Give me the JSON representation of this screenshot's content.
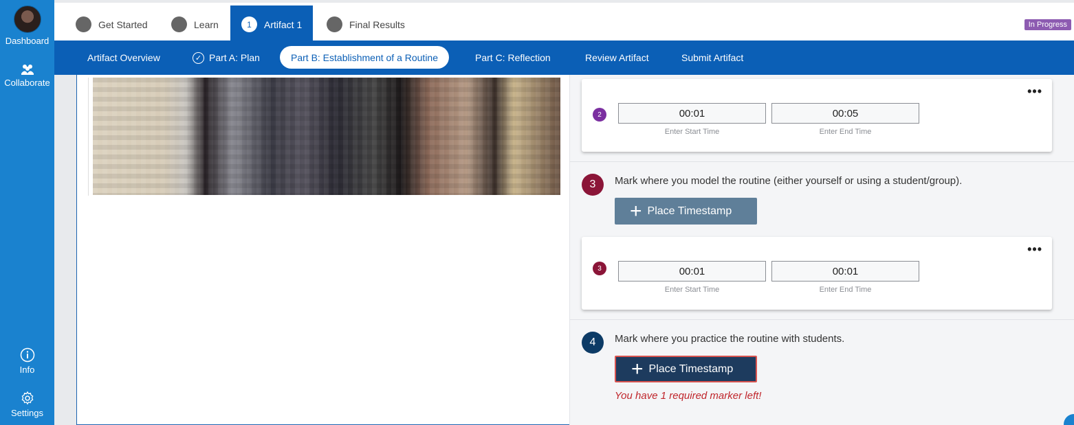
{
  "sidebar": {
    "dashboard_label": "Dashboard",
    "collaborate_label": "Collaborate",
    "info_label": "Info",
    "settings_label": "Settings"
  },
  "steps": [
    {
      "label": "Get Started",
      "state": "inactive"
    },
    {
      "label": "Learn",
      "state": "inactive"
    },
    {
      "label": "Artifact 1",
      "number": "1",
      "state": "active"
    },
    {
      "label": "Final Results",
      "state": "inactive"
    }
  ],
  "status_badge": "In Progress",
  "subnav": [
    {
      "label": "Artifact Overview",
      "active": false
    },
    {
      "label": "Part A: Plan",
      "active": false,
      "completed": true
    },
    {
      "label": "Part B: Establishment of a Routine",
      "active": true
    },
    {
      "label": "Part C: Reflection",
      "active": false
    },
    {
      "label": "Review Artifact",
      "active": false
    },
    {
      "label": "Submit Artifact",
      "active": false
    }
  ],
  "cards": [
    {
      "marker": "2",
      "start": "00:01",
      "end": "00:05",
      "start_label": "Enter Start Time",
      "end_label": "Enter End Time",
      "color": "#7b2fa0"
    },
    {
      "marker": "3",
      "start": "00:01",
      "end": "00:01",
      "start_label": "Enter Start Time",
      "end_label": "Enter End Time",
      "color": "#8b1538"
    }
  ],
  "menu_glyph": "•••",
  "sections": [
    {
      "number": "3",
      "text": "Mark where you model the routine (either yourself or using a student/group).",
      "button": "Place Timestamp",
      "color": "#8b1538",
      "button_color": "#5f7f99"
    },
    {
      "number": "4",
      "text": "Mark where you practice the routine with students.",
      "button": "Place Timestamp",
      "color": "#0d3b66",
      "button_color": "#1d3b5e",
      "warning": "You have 1 required marker left!"
    }
  ],
  "colors": {
    "sidebar": "#1a82cf",
    "primary": "#0b5fb6",
    "badge": "#8d5bb1",
    "warning": "#c0262c"
  }
}
